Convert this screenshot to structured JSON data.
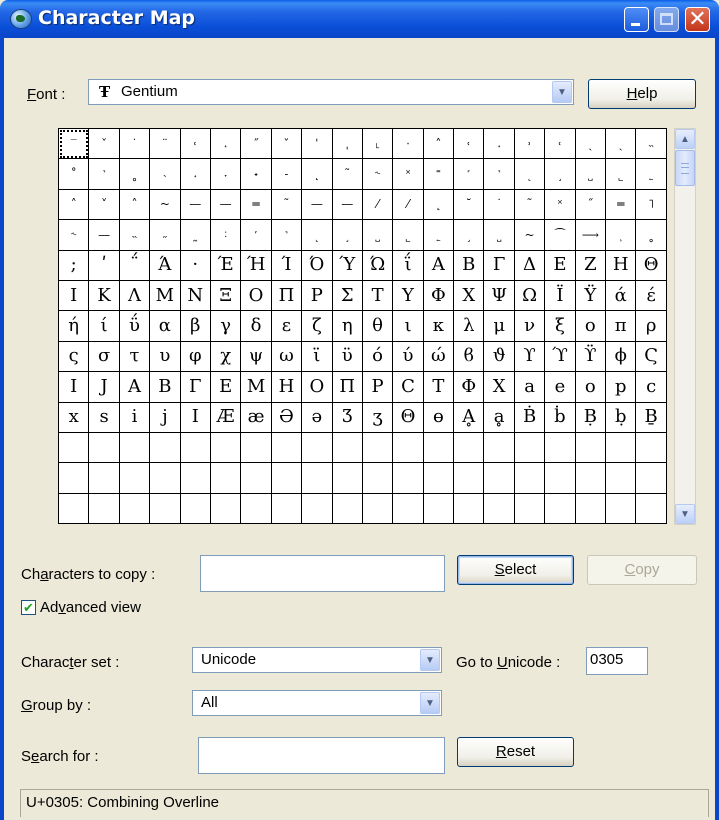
{
  "window": {
    "title": "Character Map"
  },
  "font": {
    "label_pre": "",
    "label_key": "F",
    "label_post": "ont :",
    "value": "Gentium",
    "font_type_glyph": "Ŧ"
  },
  "help_button": {
    "pre": "",
    "key": "H",
    "post": "elp"
  },
  "grid": {
    "selected_index": 0,
    "cells": [
      "‾",
      "ˇ",
      "˙",
      "¨",
      "˓",
      "˔",
      "˝",
      "ˇ",
      "ˈ",
      "ˌ",
      "˪",
      "ˑ",
      "˄",
      "˓",
      "˔",
      "˒",
      "˓",
      "ˎ",
      "ˏ",
      "˵",
      "˚",
      "˺",
      "˳",
      "˴",
      "˔",
      "˕",
      "˖",
      "˗",
      "˛",
      "˜",
      "˞",
      "˟",
      "˭",
      "˹",
      "˺",
      "˻",
      "˼",
      "˽",
      "˾",
      "˿",
      "˄",
      "˅",
      "˄",
      "~",
      "—",
      "—",
      "═",
      "˜",
      "—",
      "—",
      "⁄",
      "⁄",
      "˛",
      "˘",
      "˙",
      "˜",
      "˟",
      "˝",
      "═",
      "˥",
      "˞",
      "—",
      "˵",
      "˶",
      "˷",
      "˸",
      "˹",
      "˺",
      "˻",
      "˼",
      "˽",
      "˾",
      "˿",
      "˼",
      "˽",
      "~",
      "⁀",
      "⟶",
      "˲",
      "˳",
      ";",
      "ʹ",
      "΅",
      "Ά",
      "·",
      "Έ",
      "Ή",
      "Ί",
      "Ό",
      "Ύ",
      "Ώ",
      "ΐ",
      "Α",
      "Β",
      "Γ",
      "Δ",
      "Ε",
      "Ζ",
      "Η",
      "Θ",
      "Ι",
      "Κ",
      "Λ",
      "Μ",
      "Ν",
      "Ξ",
      "Ο",
      "Π",
      "Ρ",
      "Σ",
      "Τ",
      "Υ",
      "Φ",
      "Χ",
      "Ψ",
      "Ω",
      "Ϊ",
      "Ϋ",
      "ά",
      "έ",
      "ή",
      "ί",
      "ΰ",
      "α",
      "β",
      "γ",
      "δ",
      "ε",
      "ζ",
      "η",
      "θ",
      "ι",
      "κ",
      "λ",
      "μ",
      "ν",
      "ξ",
      "ο",
      "π",
      "ρ",
      "ς",
      "σ",
      "τ",
      "υ",
      "φ",
      "χ",
      "ψ",
      "ω",
      "ϊ",
      "ϋ",
      "ό",
      "ύ",
      "ώ",
      "ϐ",
      "ϑ",
      "ϒ",
      "ϓ",
      "ϔ",
      "ϕ",
      "Ϛ",
      "Ι",
      "Ј",
      "Α",
      "Β",
      "Γ",
      "Ε",
      "Μ",
      "Η",
      "Ο",
      "Π",
      "Ρ",
      "С",
      "Т",
      "Φ",
      "Χ",
      "а",
      "е",
      "о",
      "р",
      "с",
      "х",
      "ѕ",
      "і",
      "ј",
      "Ι",
      "Æ",
      "æ",
      "Ə",
      "ə",
      "Ʒ",
      "ʒ",
      "Θ",
      "ɵ",
      "Ḁ",
      "ḁ",
      "Ḃ",
      "ḃ",
      "Ḅ",
      "ḅ",
      "Ḇ"
    ]
  },
  "copy_row": {
    "label_pre": "Ch",
    "label_key": "a",
    "label_post": "racters to copy :",
    "value": "",
    "select": {
      "pre": "",
      "key": "S",
      "post": "elect"
    },
    "copy": {
      "pre": "",
      "key": "C",
      "post": "opy"
    }
  },
  "advanced": {
    "label_pre": "Ad",
    "label_key": "v",
    "label_post": "anced view",
    "checked": "✔"
  },
  "charset": {
    "label_pre": "Charac",
    "label_key": "t",
    "label_post": "er set :",
    "value": "Unicode",
    "goto_pre": "Go to ",
    "goto_key": "U",
    "goto_post": "nicode :",
    "goto_value": "0305"
  },
  "groupby": {
    "label_pre": "",
    "label_key": "G",
    "label_post": "roup by :",
    "value": "All"
  },
  "search": {
    "label_pre": "S",
    "label_key": "e",
    "label_post": "arch for :",
    "value": "",
    "reset": {
      "pre": "",
      "key": "R",
      "post": "eset"
    }
  },
  "status": {
    "text": "U+0305: Combining Overline"
  }
}
